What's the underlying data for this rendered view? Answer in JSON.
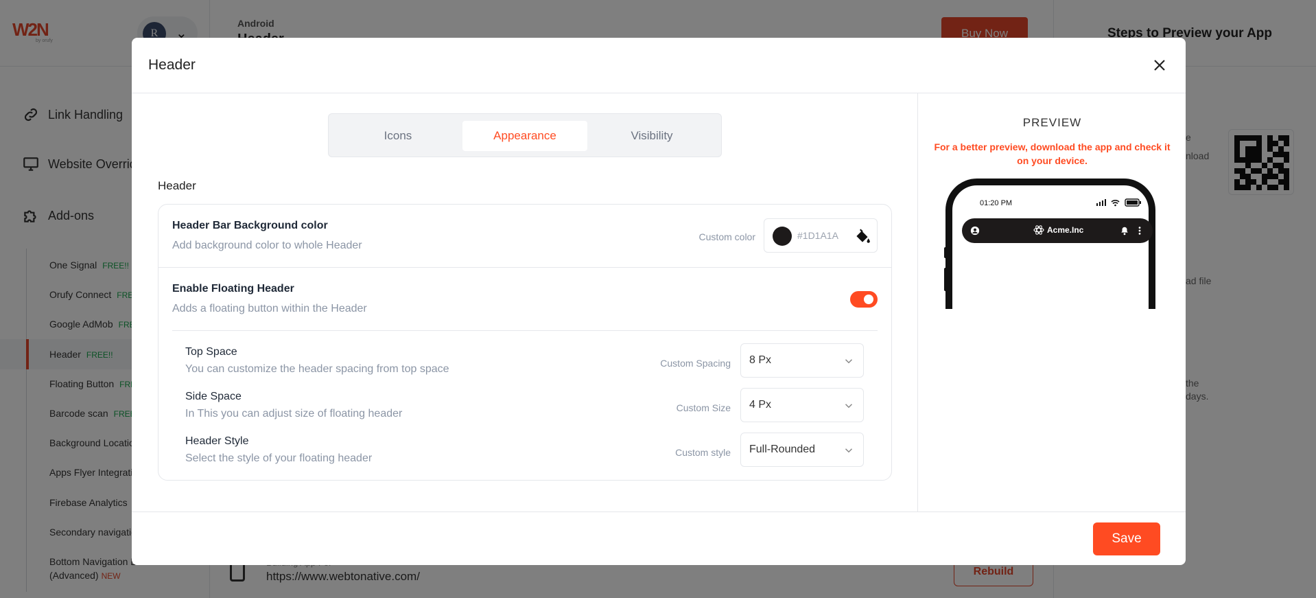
{
  "background": {
    "logo_text": "W2N",
    "logo_by": "by orufy",
    "avatar_initial": "R",
    "breadcrumb_small": "Android",
    "breadcrumb_big": "Header",
    "buy_now": "Buy Now",
    "steps_title": "Steps to Preview your App",
    "nav_main": [
      {
        "label": "Link Handling",
        "icon": "link-icon"
      },
      {
        "label": "Website Overrides",
        "icon": "monitor-icon"
      },
      {
        "label": "Add-ons",
        "icon": "puzzle-icon"
      }
    ],
    "addons": [
      {
        "label": "One Signal",
        "tag": "FREE!!"
      },
      {
        "label": "Orufy Connect",
        "tag": "FREE!!"
      },
      {
        "label": "Google AdMob",
        "tag": "FREE!!"
      },
      {
        "label": "Header",
        "tag": "FREE!!"
      },
      {
        "label": "Floating Button",
        "tag": "FREE!!"
      },
      {
        "label": "Barcode scan",
        "tag": "FREE!!"
      },
      {
        "label": "Background Location",
        "tag": ""
      },
      {
        "label": "Apps Flyer Integration",
        "tag": ""
      },
      {
        "label": "Firebase Analytics",
        "tag": ""
      },
      {
        "label": "Secondary navigation",
        "tag": ""
      },
      {
        "label": "Bottom Navigation Bar",
        "tag": ""
      },
      {
        "label": "(Advanced)",
        "tag": "NEW"
      }
    ],
    "right_fragments": [
      "e",
      "nload",
      "ad file",
      "the",
      "days."
    ],
    "url_label": "Building App For",
    "url": "https://www.webtonative.com/",
    "rebuild": "Rebuild"
  },
  "modal": {
    "title": "Header",
    "tabs": [
      "Icons",
      "Appearance",
      "Visibility"
    ],
    "active_tab": "Appearance",
    "section_label": "Header",
    "bg_color": {
      "title": "Header Bar Background color",
      "desc": "Add background color to whole Header",
      "hint": "Custom color",
      "value": "#1D1A1A"
    },
    "floating": {
      "title": "Enable Floating Header",
      "desc": "Adds a floating button within the Header",
      "enabled": true
    },
    "top_space": {
      "title": "Top Space",
      "desc": "You can customize the header spacing from top space",
      "hint": "Custom Spacing",
      "value": "8 Px"
    },
    "side_space": {
      "title": "Side Space",
      "desc": "In This you can adjust size of floating header",
      "hint": "Custom Size",
      "value": "4 Px"
    },
    "header_style": {
      "title": "Header Style",
      "desc": "Select the style of your floating header",
      "hint": "Custom style",
      "value": "Full-Rounded"
    },
    "preview": {
      "title": "PREVIEW",
      "note": "For a better preview, download the app and check it on your device.",
      "time": "01:20 PM",
      "brand": "Acme.Inc"
    },
    "save": "Save"
  },
  "colors": {
    "accent": "#ff4b22",
    "header_bg": "#1D1A1A",
    "free_tag": "#16a34a"
  }
}
